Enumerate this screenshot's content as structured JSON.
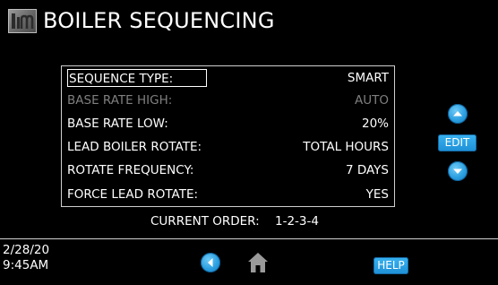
{
  "header": {
    "title": "BOILER SEQUENCING"
  },
  "settings": [
    {
      "label": "SEQUENCE TYPE:",
      "value": "SMART"
    },
    {
      "label": "BASE RATE HIGH:",
      "value": "AUTO"
    },
    {
      "label": "BASE RATE LOW:",
      "value": "20%"
    },
    {
      "label": "LEAD BOILER ROTATE:",
      "value": "TOTAL HOURS"
    },
    {
      "label": "ROTATE FREQUENCY:",
      "value": "7 DAYS"
    },
    {
      "label": "FORCE LEAD ROTATE:",
      "value": "YES"
    }
  ],
  "current_order": {
    "label": "CURRENT ORDER:",
    "value": "1-2-3-4"
  },
  "controls": {
    "edit_label": "EDIT",
    "help_label": "HELP"
  },
  "footer": {
    "date": "2/28/20",
    "time": "9:45AM"
  },
  "icons": {
    "logo": "company-logo-icon",
    "up": "arrow-up-icon",
    "down": "arrow-down-icon",
    "back": "arrow-left-icon",
    "home": "home-icon"
  },
  "colors": {
    "background": "#000000",
    "accent": "#2a9ee0",
    "disabled_text": "#7f7f7f",
    "text": "#ffffff"
  }
}
